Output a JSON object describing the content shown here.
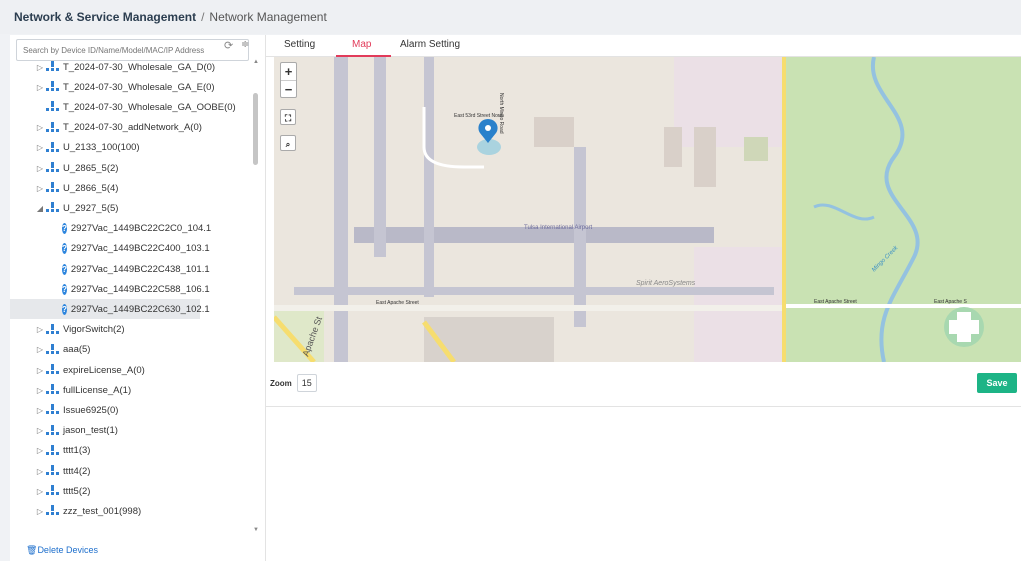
{
  "breadcrumb": {
    "main": "Network & Service Management",
    "separator": "/",
    "sub": "Network Management"
  },
  "search": {
    "placeholder": "Search by Device ID/Name/Model/MAC/IP Address"
  },
  "tree": {
    "items": [
      {
        "label": "T_2024-07-30_Wholesale_GA_D(0)",
        "type": "network",
        "caret": "▷"
      },
      {
        "label": "T_2024-07-30_Wholesale_GA_E(0)",
        "type": "network",
        "caret": "▷"
      },
      {
        "label": "T_2024-07-30_Wholesale_GA_OOBE(0)",
        "type": "network",
        "caret": ""
      },
      {
        "label": "T_2024-07-30_addNetwork_A(0)",
        "type": "network",
        "caret": "▷"
      },
      {
        "label": "U_2133_100(100)",
        "type": "network",
        "caret": "▷"
      },
      {
        "label": "U_2865_5(2)",
        "type": "network",
        "caret": "▷"
      },
      {
        "label": "U_2866_5(4)",
        "type": "network",
        "caret": "▷"
      },
      {
        "label": "U_2927_5(5)",
        "type": "network",
        "caret": "◢"
      },
      {
        "label": "2927Vac_1449BC22C2C0_104.1",
        "type": "device"
      },
      {
        "label": "2927Vac_1449BC22C400_103.1",
        "type": "device"
      },
      {
        "label": "2927Vac_1449BC22C438_101.1",
        "type": "device"
      },
      {
        "label": "2927Vac_1449BC22C588_106.1",
        "type": "device"
      },
      {
        "label": "2927Vac_1449BC22C630_102.1",
        "type": "device",
        "selected": true
      },
      {
        "label": "VigorSwitch(2)",
        "type": "network",
        "caret": "▷"
      },
      {
        "label": "aaa(5)",
        "type": "network",
        "caret": "▷"
      },
      {
        "label": "expireLicense_A(0)",
        "type": "network",
        "caret": "▷"
      },
      {
        "label": "fullLicense_A(1)",
        "type": "network",
        "caret": "▷"
      },
      {
        "label": "Issue6925(0)",
        "type": "network",
        "caret": "▷"
      },
      {
        "label": "jason_test(1)",
        "type": "network",
        "caret": "▷"
      },
      {
        "label": "tttt1(3)",
        "type": "network",
        "caret": "▷"
      },
      {
        "label": "tttt4(2)",
        "type": "network",
        "caret": "▷"
      },
      {
        "label": "tttt5(2)",
        "type": "network",
        "caret": "▷"
      },
      {
        "label": "zzz_test_001(998)",
        "type": "network",
        "caret": "▷"
      }
    ]
  },
  "delete_label": "Delete Devices",
  "tabs": [
    {
      "label": "Setting"
    },
    {
      "label": "Map",
      "active": true
    },
    {
      "label": "Alarm Setting"
    }
  ],
  "map": {
    "zoom_in": "+",
    "zoom_out": "−",
    "labels": {
      "airport": "Tulsa International Airport",
      "spirit": "Spirit AeroSystems",
      "apache_w": "East Apache Street",
      "apache_e": "East Apache Street",
      "apache_far": "East Apache S",
      "street_n": "East 53rd Street North",
      "avenue": "North Mingo Road",
      "creek": "Mingo Creek",
      "apache_left": "Apache St"
    }
  },
  "zoom": {
    "label": "Zoom",
    "value": "15"
  },
  "save_label": "Save",
  "colors": {
    "accent": "#e23b5a",
    "save": "#1db486",
    "network_icon": "#2f7fd1",
    "device_icon": "#2e86de"
  }
}
